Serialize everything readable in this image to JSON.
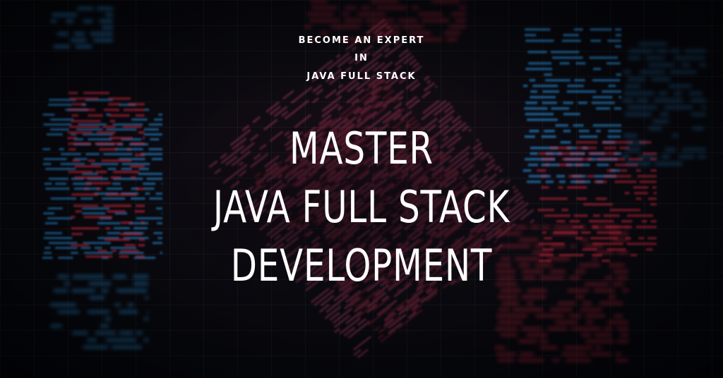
{
  "tagline": {
    "line1": "BECOME AN EXPERT",
    "line2": "IN",
    "line3": "JAVA FULL STACK"
  },
  "headline": {
    "line1": "MASTER",
    "line2": "JAVA FULL STACK",
    "line3": "DEVELOPMENT"
  },
  "colors": {
    "background": "#05070b",
    "text": "#ffffff",
    "code_blue": "#2ea8ff",
    "code_red": "#ff2d4a",
    "code_pink": "#ff5a8a"
  },
  "background": {
    "subject": "abstract glowing source code lines"
  }
}
